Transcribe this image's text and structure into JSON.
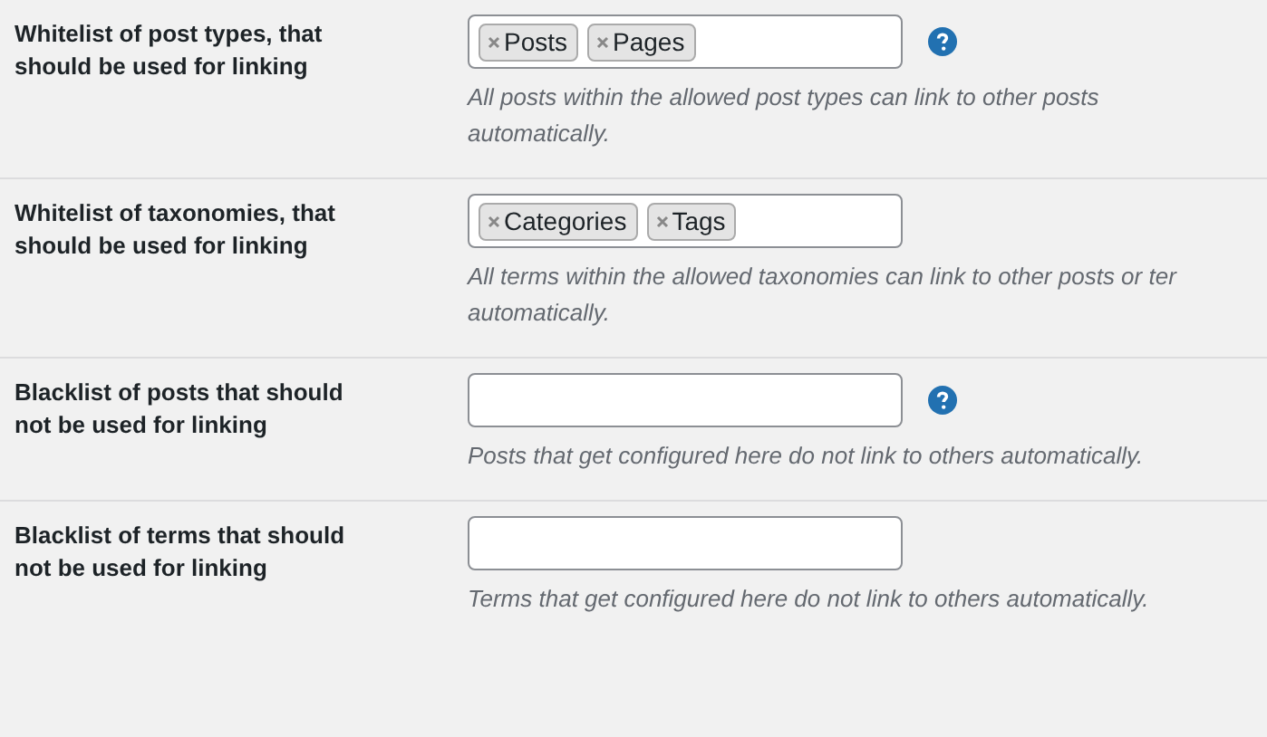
{
  "settings": [
    {
      "label": "Whitelist of post types, that should be used for linking",
      "tags": [
        "Posts",
        "Pages"
      ],
      "help": true,
      "description": "All posts within the allowed post types can link to other posts\nautomatically."
    },
    {
      "label": "Whitelist of taxonomies, that should be used for linking",
      "tags": [
        "Categories",
        "Tags"
      ],
      "help": false,
      "description": "All terms within the allowed taxonomies can link to other posts or ter\nautomatically."
    },
    {
      "label": "Blacklist of posts that should not be used for linking",
      "help": true,
      "description": "Posts that get configured here do not link to others automatically."
    },
    {
      "label": "Blacklist of terms that should not be used for linking",
      "help": false,
      "description": "Terms that get configured here do not link to others automatically."
    }
  ]
}
